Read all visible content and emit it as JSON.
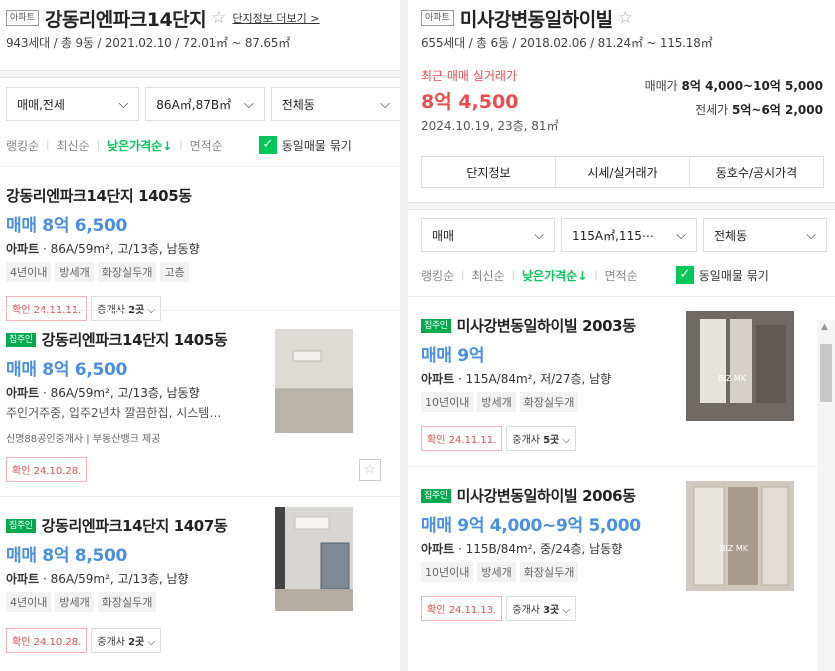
{
  "left": {
    "type_tag": "아파트",
    "name": "강동리엔파크14단지",
    "more_link": "단지정보 더보기 >",
    "summary": "943세대 / 총 9동 / 2021.02.10 / 72.01㎡ ~ 87.65㎡",
    "filters": [
      "매매,전세",
      "86A㎡,87B㎡",
      "전체동"
    ],
    "sort": [
      "랭킹순",
      "최신순",
      "낮은가격순↓",
      "면적순"
    ],
    "group_label": "동일매물 묶기",
    "listings": [
      {
        "badge": "",
        "title": "강동리엔파크14단지 1405동",
        "price": "매매 8억 6,500",
        "spec_type": "아파트",
        "spec_rest": " · 86A/59m², 고/13층, 남동향",
        "desc": "",
        "tags": [
          "4년이내",
          "방세개",
          "화장실두개",
          "고층"
        ],
        "provider": "",
        "confirm": "확인 24.11.11.",
        "agents_prefix": "중개사 ",
        "agents_count": "2곳",
        "agents_suffix": " ⌵"
      },
      {
        "badge": "집주인",
        "title": "강동리엔파크14단지 1405동",
        "price": "매매 8억 6,500",
        "spec_type": "아파트",
        "spec_rest": " · 86A/59m², 고/13층, 남동향",
        "desc": "주인거주중, 입주2년차 깔끔한집, 시스템…",
        "tags": [],
        "provider": "신명88공인중개사 | 부동산뱅크 제공",
        "confirm": "확인 24.10.28.",
        "agents_prefix": "",
        "agents_count": "",
        "agents_suffix": ""
      },
      {
        "badge": "집주인",
        "title": "강동리엔파크14단지 1407동",
        "price": "매매 8억 8,500",
        "spec_type": "아파트",
        "spec_rest": " · 86A/59m², 고/13층, 남향",
        "desc": "",
        "tags": [
          "4년이내",
          "방세개",
          "화장실두개"
        ],
        "provider": "",
        "confirm": "확인 24.10.28.",
        "agents_prefix": "중개사 ",
        "agents_count": "2곳",
        "agents_suffix": " ⌵"
      }
    ]
  },
  "right": {
    "type_tag": "아파트",
    "name": "미사강변동일하이빌",
    "summary": "655세대 / 총 6동 / 2018.02.06 / 81.24㎡ ~ 115.18㎡",
    "recent_label": "최근 매매 실거래가",
    "recent_price": "8억 4,500",
    "recent_date": "2024.10.19, 23층, 81㎡",
    "sale_label": "매매가 ",
    "sale_range": "8억 4,000~10억 5,000",
    "rent_label": "전세가 ",
    "rent_range": "5억~6억 2,000",
    "tabs": [
      "단지정보",
      "시세/실거래가",
      "동호수/공시가격"
    ],
    "filters": [
      "매매",
      "115A㎡,115⋯",
      "전체동"
    ],
    "sort": [
      "랭킹순",
      "최신순",
      "낮은가격순↓",
      "면적순"
    ],
    "group_label": "동일매물 묶기",
    "watermark": "BIZ MK",
    "listings": [
      {
        "badge": "집주인",
        "title": "미사강변동일하이빌 2003동",
        "price": "매매 9억",
        "spec_type": "아파트",
        "spec_rest": " · 115A/84m², 저/27층, 남향",
        "tags": [
          "10년이내",
          "방세개",
          "화장실두개"
        ],
        "confirm": "확인 24.11.11.",
        "agents_prefix": "중개사 ",
        "agents_count": "5곳",
        "agents_suffix": " ⌵"
      },
      {
        "badge": "집주인",
        "title": "미사강변동일하이빌 2006동",
        "price": "매매 9억 4,000~9억 5,000",
        "spec_type": "아파트",
        "spec_rest": " · 115B/84m², 중/24층, 남동향",
        "tags": [
          "10년이내",
          "방세개",
          "화장실두개"
        ],
        "confirm": "확인 24.11.13.",
        "agents_prefix": "중개사 ",
        "agents_count": "3곳",
        "agents_suffix": " ⌵"
      }
    ]
  },
  "colors": {
    "accent_green": "#03c75a",
    "price_blue": "#4a90e2",
    "alert_red": "#e94c4c"
  }
}
